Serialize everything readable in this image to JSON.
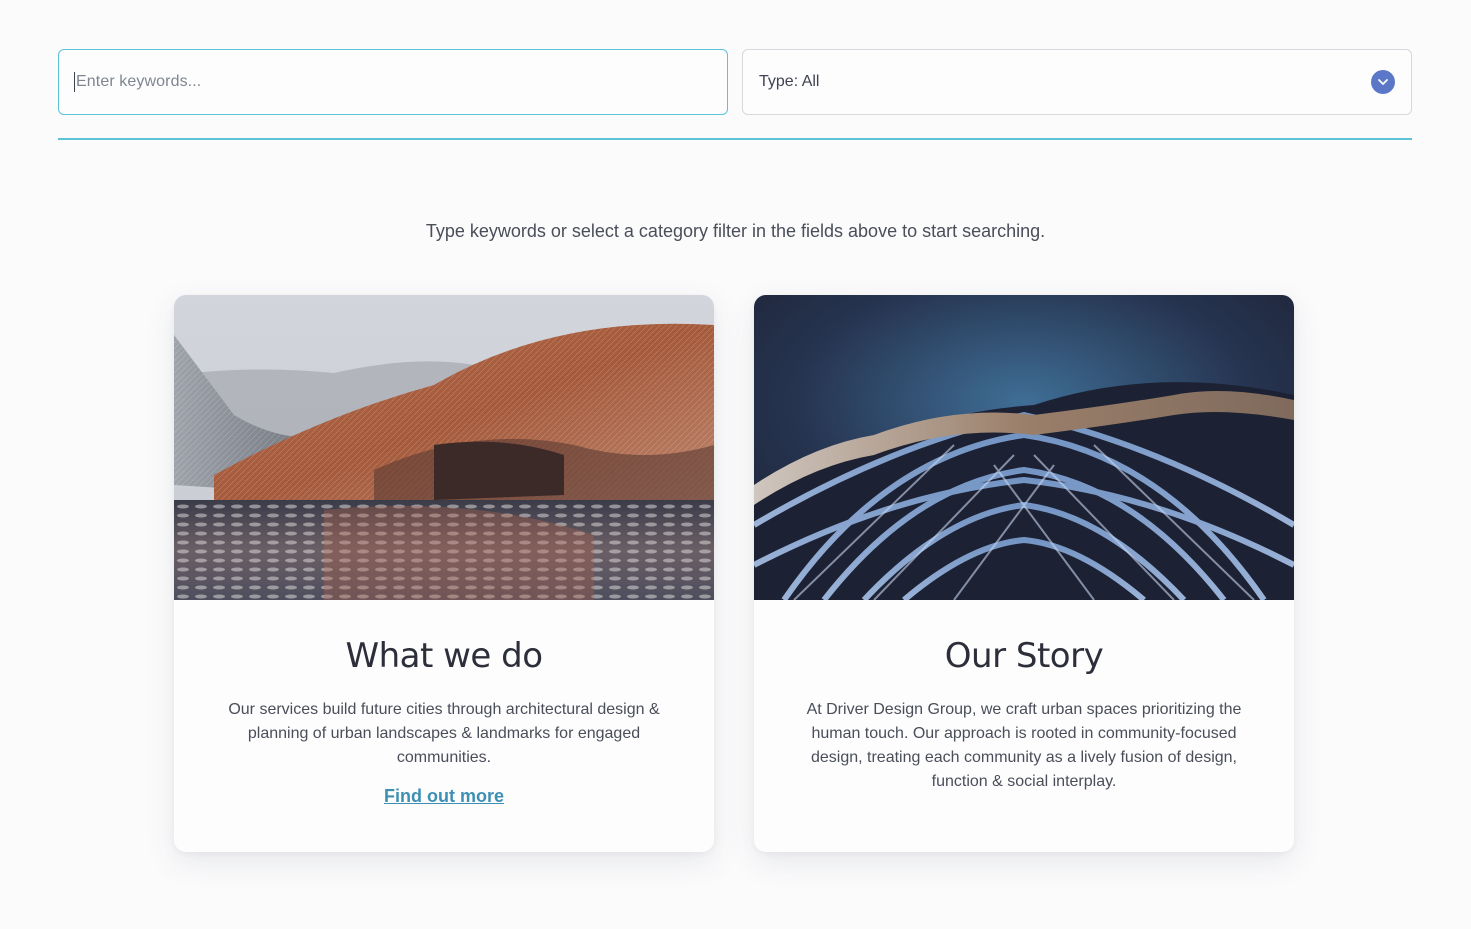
{
  "search": {
    "keyword_placeholder": "Enter keywords...",
    "type_filter_value": "Type: All"
  },
  "hint_text": "Type keywords or select a category filter in the fields above to start searching.",
  "cards": [
    {
      "title": "What we do",
      "text": "Our services build future cities through architectural design & planning of urban landscapes & landmarks for engaged communities.",
      "link_label": "Find out more"
    },
    {
      "title": "Our Story",
      "text": "At Driver Design Group, we craft urban spaces prioritizing the human touch. Our approach is rooted in community-focused design, treating each community as a lively fusion of design, function & social interplay."
    }
  ],
  "colors": {
    "accent": "#5cc3d6",
    "dropdown_icon": "#5b78c8",
    "link": "#3e8fb4"
  }
}
